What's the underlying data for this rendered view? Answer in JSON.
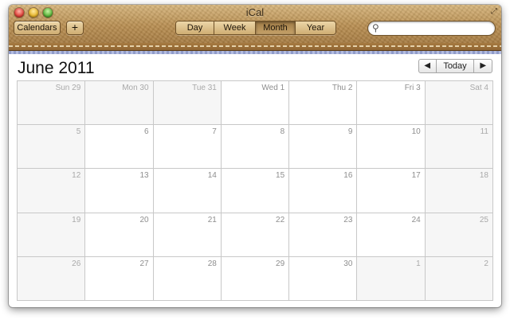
{
  "window": {
    "title": "iCal"
  },
  "toolbar": {
    "calendars_label": "Calendars",
    "add_label": "+",
    "views": [
      {
        "label": "Day",
        "active": false
      },
      {
        "label": "Week",
        "active": false
      },
      {
        "label": "Month",
        "active": true
      },
      {
        "label": "Year",
        "active": false
      }
    ],
    "search": {
      "value": "",
      "placeholder": ""
    }
  },
  "calendar": {
    "month_title": "June 2011",
    "nav": {
      "prev": "◀",
      "today": "Today",
      "next": "▶"
    },
    "day_headers": [
      "Sun 29",
      "Mon 30",
      "Tue 31",
      "Wed 1",
      "Thu 2",
      "Fri 3",
      "Sat 4"
    ],
    "weeks": [
      [
        "5",
        "6",
        "7",
        "8",
        "9",
        "10",
        "11"
      ],
      [
        "12",
        "13",
        "14",
        "15",
        "16",
        "17",
        "18"
      ],
      [
        "19",
        "20",
        "21",
        "22",
        "23",
        "24",
        "25"
      ],
      [
        "26",
        "27",
        "28",
        "29",
        "30",
        "1",
        "2"
      ]
    ]
  },
  "colors": {
    "leather": "#b98f52",
    "stitch": "#f2e2bd",
    "grid_line": "#c8c8c8",
    "date_text": "#8e8e8e"
  }
}
